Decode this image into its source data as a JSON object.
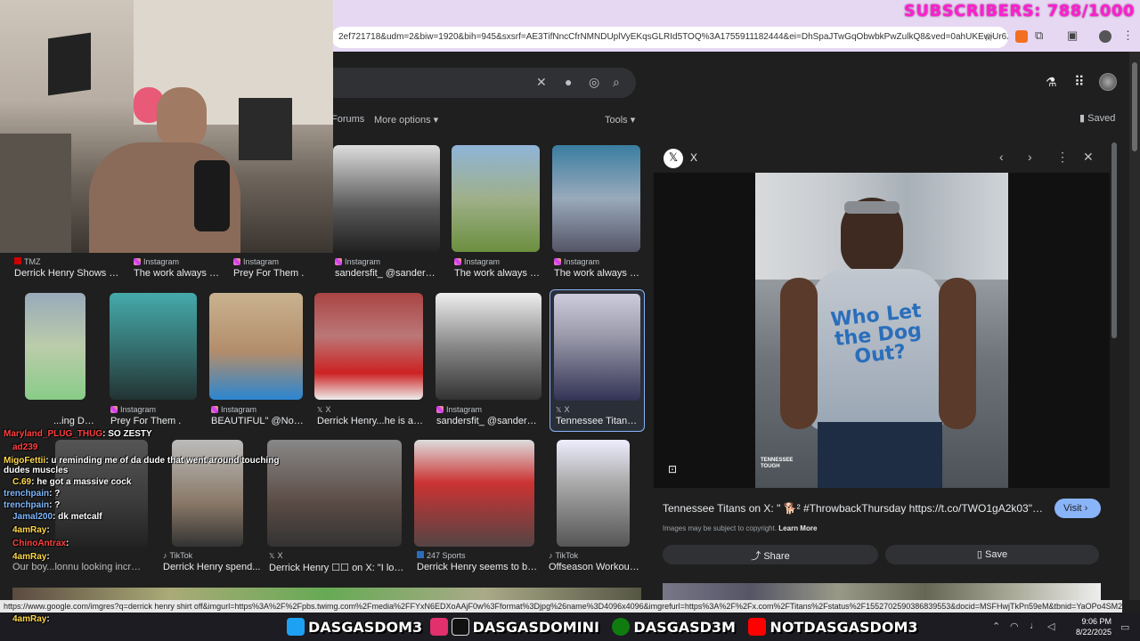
{
  "overlay": {
    "subscribers": "SUBSCRIBERS: 788/1000"
  },
  "browser": {
    "url": "2ef721718&udm=2&biw=1920&bih=945&sxsrf=AE3TifNncCfrNMNDUplVyEKqsGLRId5TOQ%3A1755911182444&ei=DhSpaJTwGqObwbkPwZulkQ8&ved=0ahUKEwiUr6Xy3p..."
  },
  "search": {
    "tabs": [
      "Forums",
      "More options"
    ],
    "tools_label": "Tools",
    "saved_label": "Saved"
  },
  "grid": {
    "row1": [
      {
        "source": "TMZ",
        "caption": "Derrick Henry Shows Off..."
      },
      {
        "source": "Instagram",
        "caption": "The work always co..."
      },
      {
        "source": "Instagram",
        "caption": "Prey For Them ."
      },
      {
        "source": "Instagram",
        "caption": "sandersfit_ @sandersfit..."
      },
      {
        "source": "Instagram",
        "caption": "The work always co..."
      },
      {
        "source": "Instagram",
        "caption": "The work always co..."
      }
    ],
    "row2": [
      {
        "source": "",
        "caption": "...ing Der..."
      },
      {
        "source": "Instagram",
        "caption": "Prey For Them ."
      },
      {
        "source": "Instagram",
        "caption": "BEAUTIFUL\" @Nova..."
      },
      {
        "source": "X",
        "caption": "Derrick Henry...he is a R..."
      },
      {
        "source": "Instagram",
        "caption": "sandersfit_ @sandersfit..."
      },
      {
        "source": "X",
        "caption": "Tennessee Titans o..."
      }
    ],
    "row3": [
      {
        "source": "",
        "caption": "Our boy...lonnu looking incredibl..."
      },
      {
        "source": "TikTok",
        "caption": "Derrick Henry spend..."
      },
      {
        "source": "X",
        "caption": "Derrick Henry ☐☐ on X: \"I love y..."
      },
      {
        "source": "247 Sports",
        "caption": "Derrick Henry seems to be ..."
      },
      {
        "source": "TikTok",
        "caption": "Offseason Workouts ..."
      }
    ]
  },
  "panel": {
    "source_name": "X",
    "title": "Tennessee Titans on X: \" 🐕² #ThrowbackThursday https://t.co/TWO1gA2k03\" / X",
    "visit_label": "Visit",
    "copyright": "Images may be subject to copyright.",
    "learn_more": "Learn More",
    "share_label": "Share",
    "save_label": "Save",
    "watermark": "TENNESSEE TOUGH",
    "shirt_text": "Who Let the Dog Out?"
  },
  "chat": [
    {
      "user": "Maryland_PLUG_THUG",
      "msg": ": SO ZESTY",
      "color": "#ff4040"
    },
    {
      "user": "ad239",
      "msg": "",
      "color": "#ff4040"
    },
    {
      "user": "MigoFettii",
      "msg": ": u reminding me of da dude that went around touching dudes muscles",
      "color": "#ffd84a"
    },
    {
      "user": "C.69",
      "msg": ": he got a massive cock",
      "color": "#ffd84a"
    },
    {
      "user": "trenchpain",
      "msg": ": ?",
      "color": "#7fb8ff"
    },
    {
      "user": "trenchpain",
      "msg": ": ?",
      "color": "#7fb8ff"
    },
    {
      "user": "Jamal200",
      "msg": ": dk metcalf",
      "color": "#7fb8ff"
    },
    {
      "user": "4amRay",
      "msg": ":",
      "color": "#ffd84a"
    },
    {
      "user": "ChinoAntrax",
      "msg": ":",
      "color": "#ff4040"
    },
    {
      "user": "4amRay",
      "msg": ":",
      "color": "#ffd84a"
    },
    {
      "user": "4amRay",
      "msg": ":",
      "color": "#ffd84a"
    }
  ],
  "status_url": "https://www.google.com/imgres?q=derrick henry shirt off&imgurl=https%3A%2F%2Fpbs.twimg.com%2Fmedia%2FFYxN6EDXoAAjF0w%3Fformat%3Djpg%26name%3D4096x4096&imgrefurl=https%3A%2F%2Fx.com%2FTitans%2Fstatus%2F1552702590386839553&docid=MSFHwjTkPn59eM&tbnid=YaOPo4SM2o2xAM&vet=12ahUKEwj5y_r03p-PAxWwR...",
  "socials": [
    {
      "platform": "twitter-icon",
      "handle": "DASGASDOM3",
      "color": "#1da1f2"
    },
    {
      "platform": "instagram-icon",
      "handle": "",
      "color": "#e1306c"
    },
    {
      "platform": "tiktok-icon",
      "handle": "DASGASDOMINI",
      "color": "#111111"
    },
    {
      "platform": "xbox-icon",
      "handle": "DASGASD3M",
      "color": "#107c10"
    },
    {
      "platform": "youtube-icon",
      "handle": "NOTDASGASDOM3",
      "color": "#ff0000"
    }
  ],
  "clock": {
    "time": "9:06 PM",
    "date": "8/22/2025"
  }
}
